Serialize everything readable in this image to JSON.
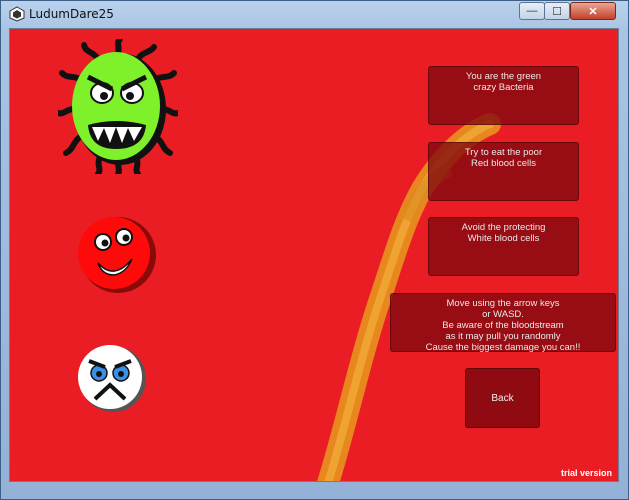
{
  "window": {
    "title": "LudumDare25",
    "controls": {
      "minimize": "—",
      "maximize": "☐",
      "close": "✕"
    }
  },
  "colors": {
    "background": "#ea1d24",
    "panel": "#80080e",
    "stream": "#e8a020"
  },
  "characters": [
    {
      "name": "green crazy bacteria",
      "icon": "bacteria-icon"
    },
    {
      "name": "red blood cell",
      "icon": "red-blood-cell-icon"
    },
    {
      "name": "white blood cell",
      "icon": "white-blood-cell-icon"
    }
  ],
  "instructions": [
    "You are the green\ncrazy Bacteria",
    "Try to eat the poor\nRed blood cells",
    "Avoid the protecting\nWhite blood cells",
    "Move using the arrow keys\nor WASD.\nBe aware of the bloodstream\nas it may pull you randomly\nCause the biggest damage you can!!"
  ],
  "back_label": "Back",
  "trial_label": "trial version"
}
